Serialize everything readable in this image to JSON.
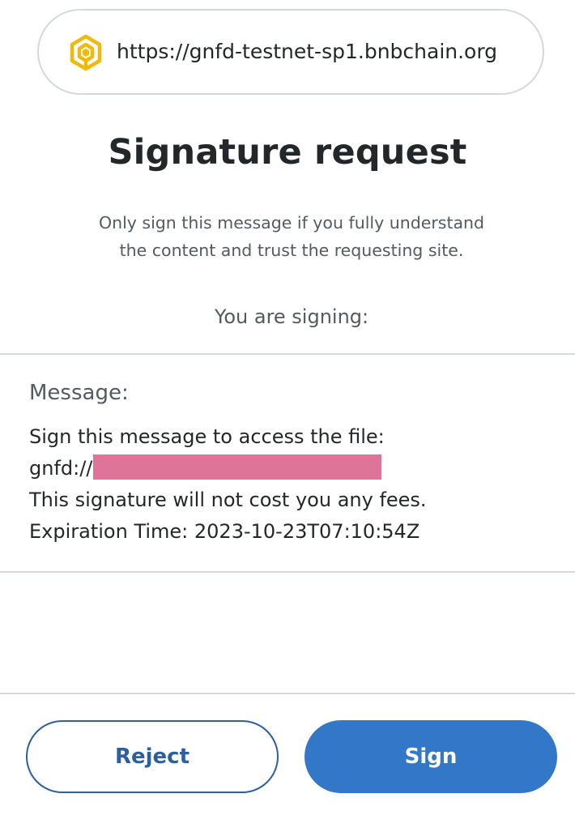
{
  "origin": {
    "url": "https://gnfd-testnet-sp1.bnbchain.org",
    "icon": "bnb-chain-cube-icon",
    "icon_color": "#f0b90b"
  },
  "title": "Signature request",
  "subtitle": {
    "line1": "Only sign this message if you fully understand",
    "line2": "the content and trust the requesting site."
  },
  "signing_label": "You are signing:",
  "message": {
    "heading": "Message:",
    "line1": "Sign this message to access the file:",
    "file_prefix": "gnfd://",
    "line3": "This signature will not cost you any fees.",
    "line4": "Expiration Time: 2023-10-23T07:10:54Z",
    "redaction_color": "#de7599"
  },
  "buttons": {
    "reject": "Reject",
    "sign": "Sign"
  },
  "colors": {
    "primary": "#3277c8",
    "reject_border": "#2a5fa0",
    "divider": "#d6d9dc"
  }
}
